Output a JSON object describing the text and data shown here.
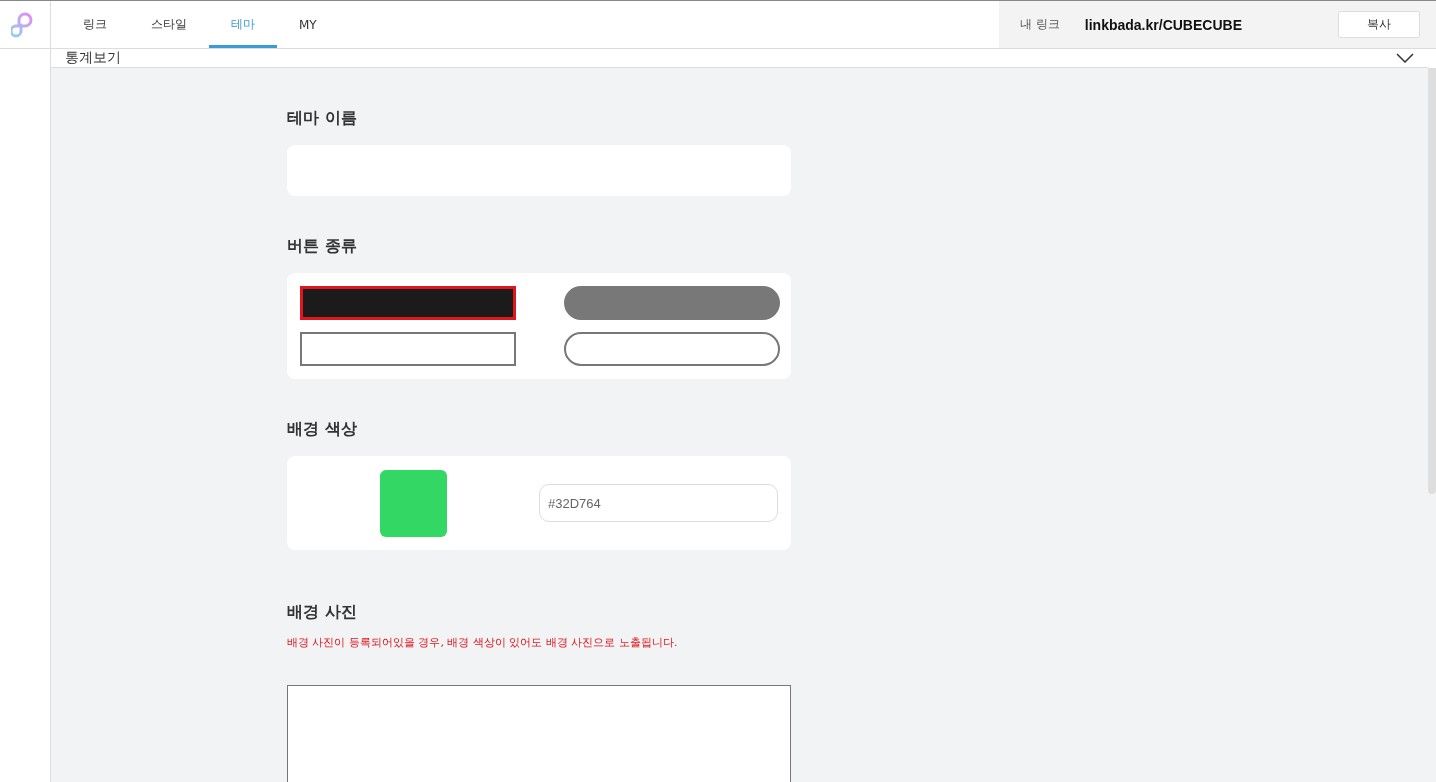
{
  "nav": {
    "tabs": [
      {
        "label": "링크",
        "selected": false
      },
      {
        "label": "스타일",
        "selected": false
      },
      {
        "label": "테마",
        "selected": true
      },
      {
        "label": "MY",
        "selected": false
      }
    ],
    "my_link": {
      "label": "내 링크",
      "url": "linkbada.kr/CUBECUBE",
      "copy_button": "복사"
    }
  },
  "stats": {
    "label": "통계보기",
    "expanded": false
  },
  "theme_name": {
    "heading": "테마 이름"
  },
  "button_type": {
    "heading": "버튼 종류",
    "options": [
      {
        "kind": "square-filled",
        "selected": true
      },
      {
        "kind": "pill-filled",
        "selected": false
      },
      {
        "kind": "square-outline",
        "selected": false
      },
      {
        "kind": "pill-outline",
        "selected": false
      }
    ]
  },
  "background_color": {
    "heading": "배경 색상",
    "color": "#32d764",
    "value": "#32D764"
  },
  "background_photo": {
    "heading": "배경 사진",
    "notice": "배경 사진이 등록되어있을 경우, 배경 색상이 있어도 배경 사진으로 노출됩니다."
  }
}
